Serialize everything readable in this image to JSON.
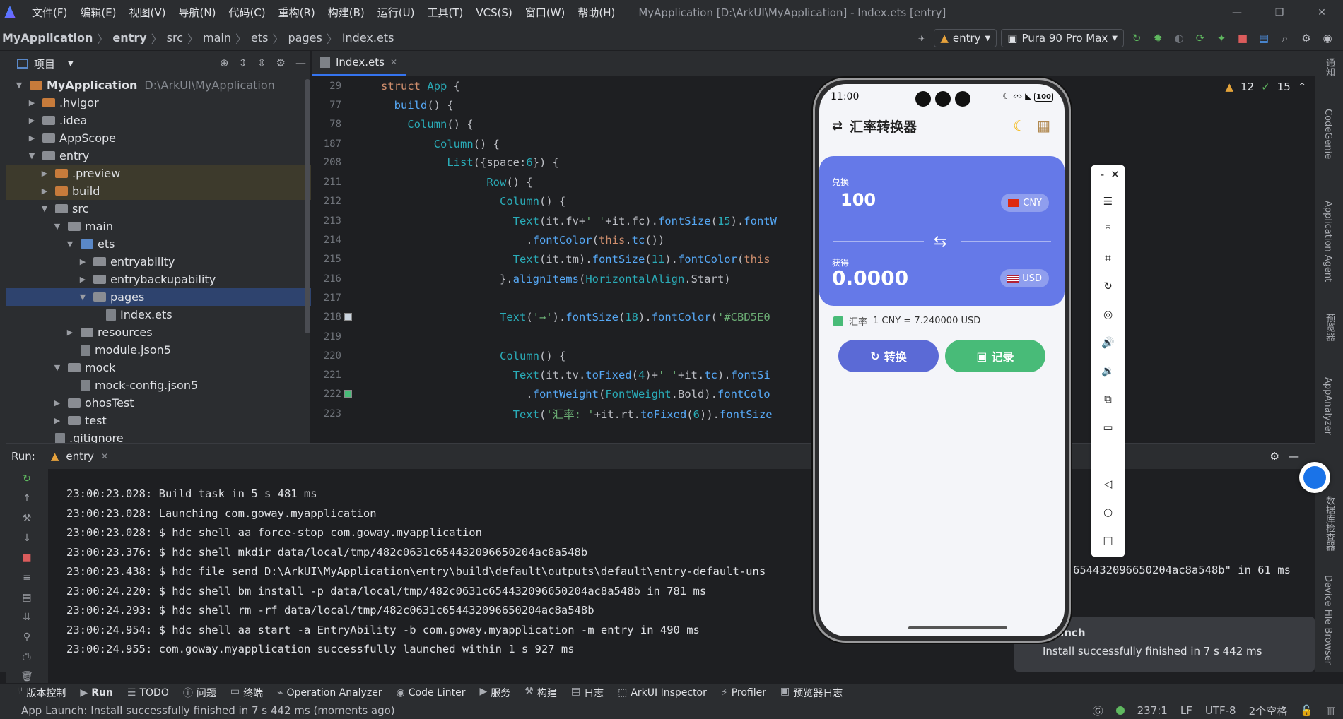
{
  "menu": [
    "文件(F)",
    "编辑(E)",
    "视图(V)",
    "导航(N)",
    "代码(C)",
    "重构(R)",
    "构建(B)",
    "运行(U)",
    "工具(T)",
    "VCS(S)",
    "窗口(W)",
    "帮助(H)"
  ],
  "window_title": "MyApplication [D:\\ArkUI\\MyApplication] - Index.ets [entry]",
  "breadcrumb": [
    "MyApplication",
    "entry",
    "src",
    "main",
    "ets",
    "pages",
    "Index.ets"
  ],
  "run_config": "entry",
  "device": "Pura 90 Pro Max",
  "project_panel": {
    "title": "项目",
    "tree": [
      {
        "label": "MyApplication",
        "extra": "D:\\ArkUI\\MyApplication"
      },
      {
        "label": ".hvigor"
      },
      {
        "label": ".idea"
      },
      {
        "label": "AppScope"
      },
      {
        "label": "entry"
      },
      {
        "label": ".preview"
      },
      {
        "label": "build"
      },
      {
        "label": "src"
      },
      {
        "label": "main"
      },
      {
        "label": "ets"
      },
      {
        "label": "entryability"
      },
      {
        "label": "entrybackupability"
      },
      {
        "label": "pages"
      },
      {
        "label": "Index.ets"
      },
      {
        "label": "resources"
      },
      {
        "label": "module.json5"
      },
      {
        "label": "mock"
      },
      {
        "label": "mock-config.json5"
      },
      {
        "label": "ohosTest"
      },
      {
        "label": "test"
      },
      {
        "label": ".gitignore"
      }
    ]
  },
  "editor": {
    "tab": "Index.ets",
    "warnings": "12",
    "checks": "15",
    "lines": [
      {
        "n": "29",
        "code": "struct App {"
      },
      {
        "n": "77",
        "code": "  build() {"
      },
      {
        "n": "78",
        "code": "    Column() {"
      },
      {
        "n": "187",
        "code": "        Column() {"
      },
      {
        "n": "208",
        "code": "          List({space:6}) {"
      },
      {
        "n": "211",
        "code": "                Row() {"
      },
      {
        "n": "212",
        "code": "                  Column() {"
      },
      {
        "n": "213",
        "code": "                    Text(it.fv+' '+it.fc).fontSize(15).fontW"
      },
      {
        "n": "214",
        "code": "                      .fontColor(this.tc())"
      },
      {
        "n": "215",
        "code": "                    Text(it.tm).fontSize(11).fontColor(this"
      },
      {
        "n": "216",
        "code": "                  }.alignItems(HorizontalAlign.Start)"
      },
      {
        "n": "217",
        "code": ""
      },
      {
        "n": "218",
        "code": "                  Text('→').fontSize(18).fontColor('#CBD5E0"
      },
      {
        "n": "219",
        "code": ""
      },
      {
        "n": "220",
        "code": "                  Column() {"
      },
      {
        "n": "221",
        "code": "                    Text(it.tv.toFixed(4)+' '+it.tc).fontSi"
      },
      {
        "n": "222",
        "code": "                      .fontWeight(FontWeight.Bold).fontColo"
      },
      {
        "n": "223",
        "code": "                    Text('汇率: '+it.rt.toFixed(6)).fontSize"
      }
    ]
  },
  "run_panel": {
    "label": "Run:",
    "tab": "entry",
    "log": [
      "23:00:23.028: Build task in 5 s 481 ms",
      "23:00:23.028: Launching com.goway.myapplication",
      "23:00:23.028: $ hdc shell aa force-stop com.goway.myapplication",
      "23:00:23.376: $ hdc shell mkdir data/local/tmp/482c0631c654432096650204ac8a548b",
      "23:00:23.438: $ hdc file send D:\\ArkUI\\MyApplication\\entry\\build\\default\\outputs\\default\\entry-default-uns",
      "23:00:24.220: $ hdc shell bm install -p data/local/tmp/482c0631c654432096650204ac8a548b in 781 ms",
      "23:00:24.293: $ hdc shell rm -rf data/local/tmp/482c0631c654432096650204ac8a548b",
      "23:00:24.954: $ hdc shell aa start -a EntryAbility -b com.goway.myapplication -m entry in 490 ms",
      "23:00:24.955: com.goway.myapplication successfully launched within 1 s 927 ms"
    ],
    "log_tail": "654432096650204ac8a548b\" in 61 ms"
  },
  "toast": {
    "title": "Launch",
    "message": "Install successfully finished in 7 s 442 ms"
  },
  "phone": {
    "time": "11:00",
    "battery": "100",
    "app_title": "汇率转换器",
    "from_label": "兑换",
    "from_value": "100",
    "from_currency": "CNY",
    "to_label": "获得",
    "to_value": "0.0000",
    "to_currency": "USD",
    "rate_label": "汇率",
    "rate_text": "1 CNY = 7.240000 USD",
    "convert_button": "转换",
    "record_button": "记录",
    "colors": {
      "card": "#6579e8",
      "convert": "#5b6ad6",
      "record": "#48bb78"
    }
  },
  "right_strip": [
    "通知",
    "CodeGenie",
    "Application Agent",
    "预览器",
    "AppAnalyzer",
    "数据库检查器",
    "Device File Browser"
  ],
  "bottom_tools": [
    "版本控制",
    "Run",
    "TODO",
    "问题",
    "终端",
    "Operation Analyzer",
    "Code Linter",
    "服务",
    "构建",
    "日志",
    "ArkUI Inspector",
    "Profiler",
    "预览器日志"
  ],
  "status": {
    "message": "App Launch: Install successfully finished in 7 s 442 ms (moments ago)",
    "position": "237:1",
    "line_sep": "LF",
    "encoding": "UTF-8",
    "indent": "2个空格"
  }
}
